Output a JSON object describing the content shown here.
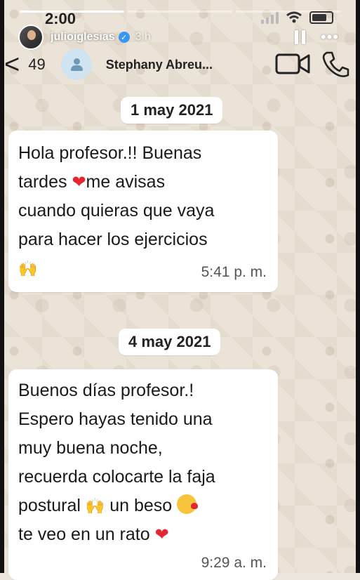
{
  "status_bar": {
    "time": "2:00"
  },
  "story": {
    "username": "julioiglesias",
    "age": "3 h",
    "more": "•••",
    "verified_mark": "✓"
  },
  "chat_header": {
    "back": "<",
    "unread_count": "49",
    "contact_name": "Stephany Abreu..."
  },
  "messages": [
    {
      "date": "1 may 2021",
      "lines": [
        "Hola profesor.!! Buenas",
        "tardes ",
        "cuando quieras que vaya",
        "para hacer los ejercicios"
      ],
      "line2_tail": "me avisas",
      "heart": "❤",
      "hands": "🙌",
      "time": "5:41 p. m."
    },
    {
      "date": "4 may 2021",
      "lines": [
        "Buenos días profesor.!",
        "Espero hayas tenido una",
        "muy buena noche,",
        "recuerda colocarte la faja",
        "postural ",
        "te veo en un rato "
      ],
      "line5_mid": " un beso ",
      "heart": "❤",
      "hands": "🙌",
      "time": "9:29 a. m."
    }
  ]
}
